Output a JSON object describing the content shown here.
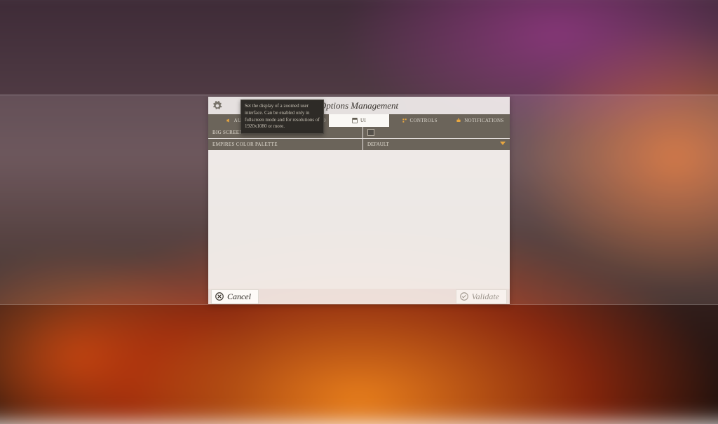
{
  "dialog": {
    "title": "Options Management",
    "tabs": [
      {
        "label": "AUDIO",
        "icon": "speaker"
      },
      {
        "label": "ADVANCED VIDEO",
        "icon": "monitor"
      },
      {
        "label": "UI",
        "icon": "ui",
        "active": true
      },
      {
        "label": "CONTROLS",
        "icon": "controls"
      },
      {
        "label": "NOTIFICATIONS",
        "icon": "bell"
      }
    ],
    "rows": [
      {
        "label": "BIG SCREEN USER INTERFACE",
        "type": "checkbox"
      },
      {
        "label": "EMPIRES COLOR PALETTE",
        "type": "select",
        "value": "DEFAULT"
      }
    ],
    "cancel": "Cancel",
    "validate": "Validate"
  },
  "tooltip": "Set the display of a zoomed user interface. Can be enabled only in fullscreen mode and for resolutions of 1920x1080 or more."
}
